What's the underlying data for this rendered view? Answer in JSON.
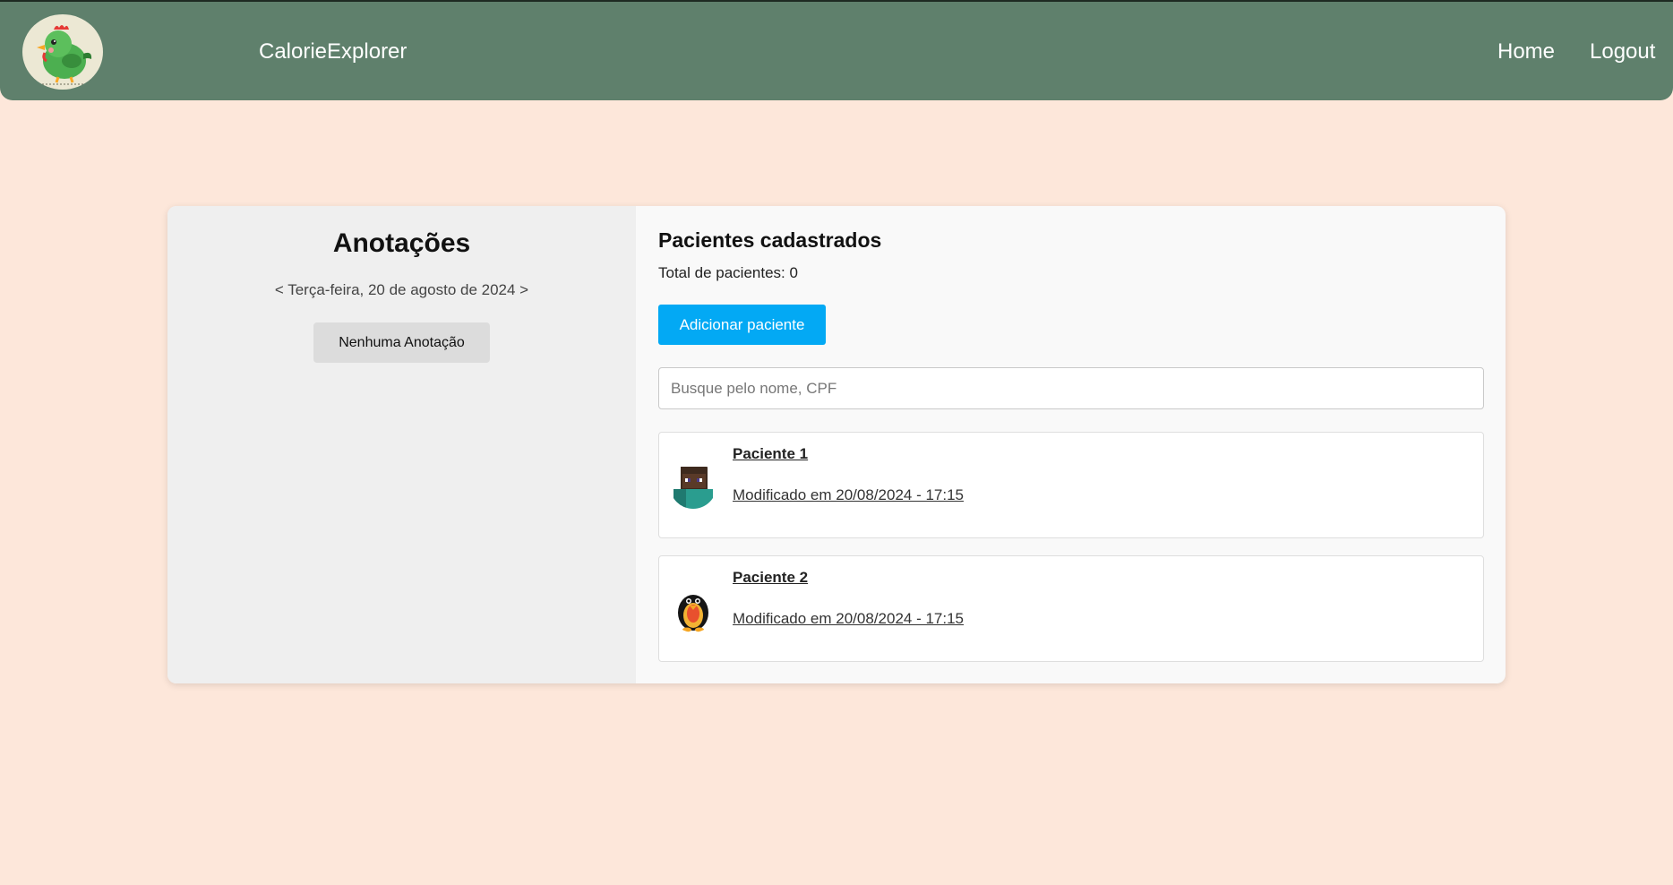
{
  "navbar": {
    "brand": "CalorieExplorer",
    "logo_icon": "chicken-logo-icon",
    "links": [
      {
        "label": "Home"
      },
      {
        "label": "Logout"
      }
    ],
    "bg_color": "#5f806c"
  },
  "notes": {
    "title": "Anotações",
    "date_nav": "< Terça-feira, 20 de agosto de 2024 >",
    "empty_label": "Nenhuma Anotação"
  },
  "patients": {
    "title": "Pacientes cadastrados",
    "total": "Total de pacientes: 0",
    "add_button": "Adicionar paciente",
    "search_placeholder": "Busque pelo nome, CPF",
    "items": [
      {
        "name": "Paciente 1",
        "modified": "Modificado em 20/08/2024 - 17:15",
        "avatar_icon": "blocky-character-avatar-icon"
      },
      {
        "name": "Paciente 2",
        "modified": "Modificado em 20/08/2024 - 17:15",
        "avatar_icon": "penguin-avatar-icon"
      }
    ],
    "accent_color": "#03a9f4"
  },
  "page_bg": "#fde7da"
}
